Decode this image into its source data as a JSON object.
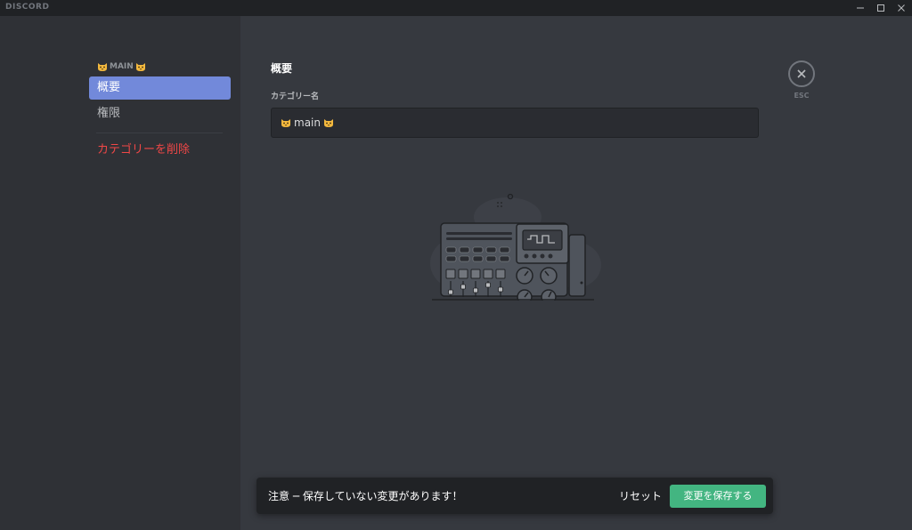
{
  "app": {
    "brand": "DISCORD"
  },
  "window_controls": [
    "minimize-icon",
    "maximize-icon",
    "close-icon"
  ],
  "sidebar": {
    "category_name": "MAIN",
    "items": [
      {
        "label": "概要",
        "active": true
      },
      {
        "label": "権限",
        "active": false
      }
    ],
    "delete_label": "カテゴリーを削除"
  },
  "main": {
    "section_title": "概要",
    "field_label": "カテゴリー名",
    "category_name_value": "main",
    "esc_label": "ESC"
  },
  "notice": {
    "message": "注意 ─ 保存していない変更があります！",
    "reset_label": "リセット",
    "save_label": "変更を保存する"
  },
  "colors": {
    "accent": "#7289da",
    "danger": "#f04747",
    "save": "#43b581"
  }
}
